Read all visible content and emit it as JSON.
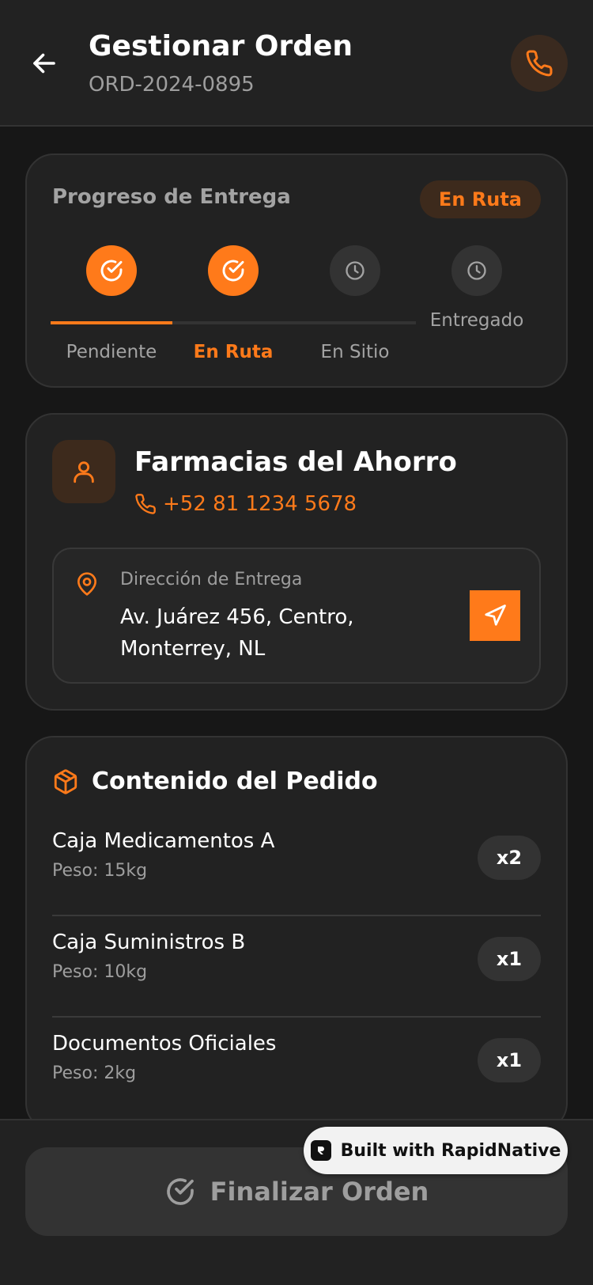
{
  "header": {
    "title": "Gestionar Orden",
    "order_id": "ORD-2024-0895",
    "back_icon": "arrow-left-icon",
    "call_icon": "phone-icon"
  },
  "progress": {
    "title": "Progreso de Entrega",
    "status": "En Ruta",
    "steps": [
      {
        "label": "Pendiente",
        "state": "done"
      },
      {
        "label": "En Ruta",
        "state": "current"
      },
      {
        "label": "En Sitio",
        "state": "pending"
      },
      {
        "label": "Entregado",
        "state": "pending"
      }
    ]
  },
  "customer": {
    "name": "Farmacias del Ahorro",
    "phone": "+52 81 1234 5678",
    "address_label": "Dirección de Entrega",
    "address": "Av. Juárez 456, Centro, Monterrey, NL"
  },
  "items": {
    "title": "Contenido del Pedido",
    "list": [
      {
        "name": "Caja Medicamentos A",
        "weight": "Peso: 15kg",
        "qty": "x2"
      },
      {
        "name": "Caja Suministros B",
        "weight": "Peso: 10kg",
        "qty": "x1"
      },
      {
        "name": "Documentos Oficiales",
        "weight": "Peso: 2kg",
        "qty": "x1"
      }
    ]
  },
  "footer": {
    "finish_label": "Finalizar Orden",
    "badge": "Built with RapidNative"
  },
  "colors": {
    "accent": "#ff7a1a",
    "background": "#171717",
    "card": "#222222"
  }
}
